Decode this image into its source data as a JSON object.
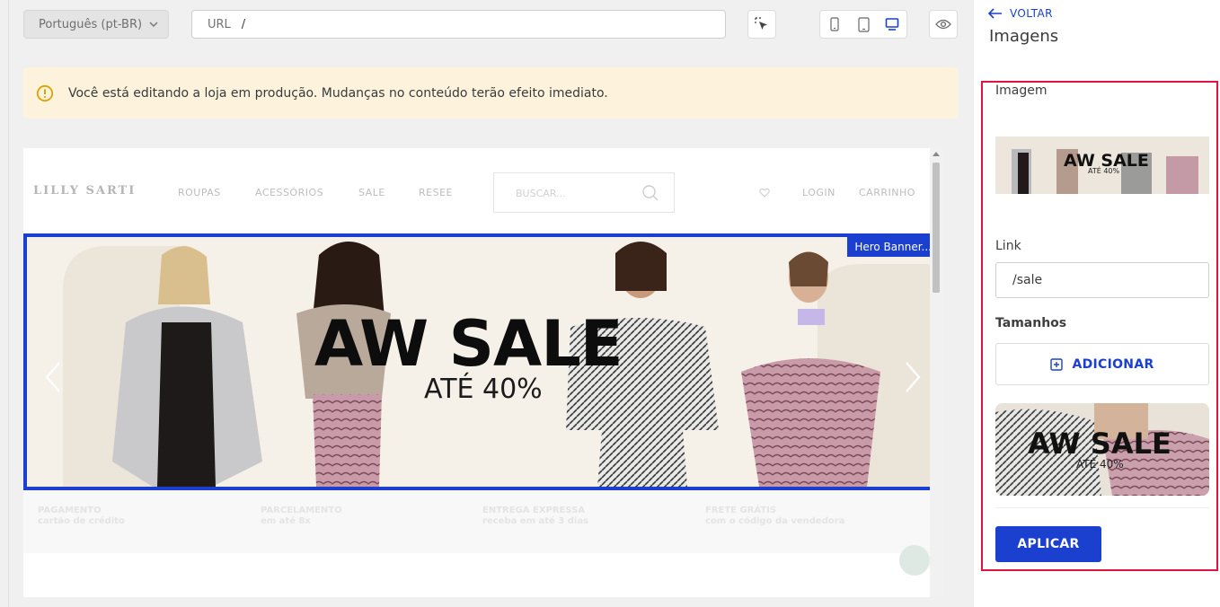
{
  "toolbar": {
    "locale": "Português (pt-BR)",
    "url_label": "URL",
    "url_value": "/"
  },
  "warning": {
    "text": "Você está editando a loja em produção. Mudanças no conteúdo terão efeito imediato."
  },
  "preview": {
    "logo": "LILLY SARTI",
    "nav": [
      "ROUPAS",
      "ACESSÓRIOS",
      "SALE",
      "RESEE"
    ],
    "search_placeholder": "BUSCAR...",
    "account": [
      "LOGIN",
      "CARRINHO"
    ],
    "hero": {
      "badge": "Hero Banner...",
      "headline": "AW SALE",
      "subline": "ATÉ 40%"
    },
    "benefits": [
      {
        "title": "PAGAMENTO",
        "sub": "cartão de crédito"
      },
      {
        "title": "PARCELAMENTO",
        "sub": "em até 8x"
      },
      {
        "title": "ENTREGA EXPRESSA",
        "sub": "receba em até 3 dias"
      },
      {
        "title": "FRETE GRÁTIS",
        "sub": "com o código da vendedora"
      }
    ]
  },
  "panel": {
    "back_label": "VOLTAR",
    "title": "Imagens",
    "image_label": "Imagem",
    "thumb": {
      "headline": "AW SALE",
      "subline": "ATÉ 40%"
    },
    "link_label": "Link",
    "link_value": "/sale",
    "sizes_label": "Tamanhos",
    "add_label": "ADICIONAR",
    "size_card": {
      "headline": "AW SALE",
      "subline": "ATÉ 40%"
    },
    "apply_label": "APLICAR"
  },
  "colors": {
    "accent": "#1b3fce",
    "highlight": "#e0143c",
    "warning_bg": "#fdf3dc"
  }
}
